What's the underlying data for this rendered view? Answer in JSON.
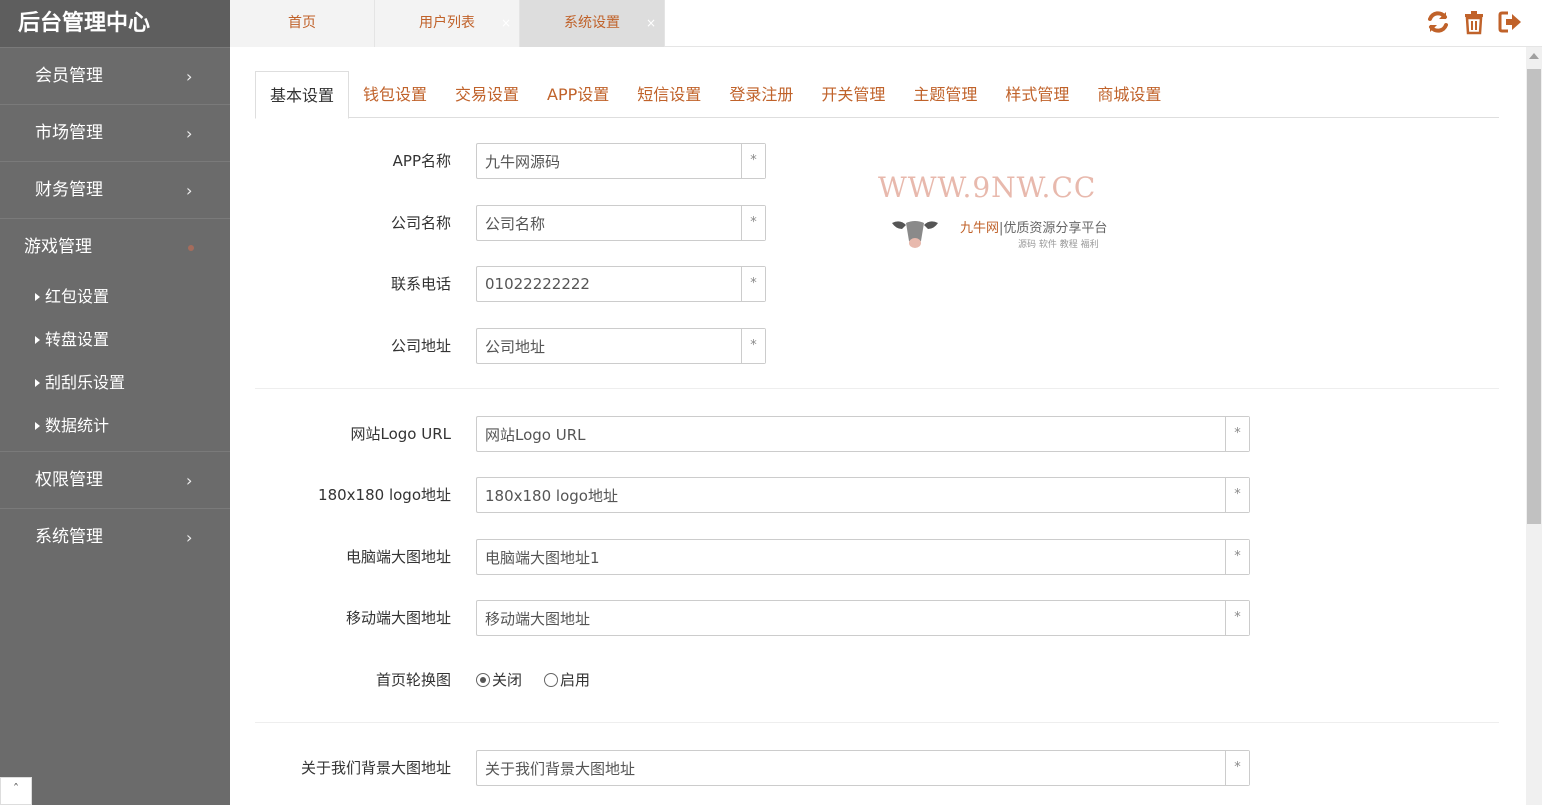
{
  "sidebar": {
    "brand": "后台管理中心",
    "items": [
      {
        "label": "会员管理",
        "chevron": "›"
      },
      {
        "label": "市场管理",
        "chevron": "›"
      },
      {
        "label": "财务管理",
        "chevron": "›"
      },
      {
        "label": "游戏管理"
      },
      {
        "label": "权限管理",
        "chevron": "›"
      },
      {
        "label": "系统管理",
        "chevron": "›"
      }
    ],
    "game_subitems": [
      "红包设置",
      "转盘设置",
      "刮刮乐设置",
      "数据统计"
    ],
    "scroll_top": "ˆ"
  },
  "page_tabs": [
    {
      "label": "首页"
    },
    {
      "label": "用户列表",
      "close": "×"
    },
    {
      "label": "系统设置",
      "close": "×"
    }
  ],
  "toolbar": {
    "icons": [
      "refresh-icon",
      "trash-icon",
      "logout-icon"
    ],
    "accent": "#c0622a"
  },
  "settings_tabs": [
    "基本设置",
    "钱包设置",
    "交易设置",
    "APP设置",
    "短信设置",
    "登录注册",
    "开关管理",
    "主题管理",
    "样式管理",
    "商城设置"
  ],
  "form": {
    "app_name": {
      "label": "APP名称",
      "value": "九牛网源码"
    },
    "company_name": {
      "label": "公司名称",
      "value": "公司名称"
    },
    "phone": {
      "label": "联系电话",
      "value": "01022222222"
    },
    "address": {
      "label": "公司地址",
      "value": "公司地址"
    },
    "logo_url": {
      "label": "网站Logo URL",
      "value": "网站Logo URL"
    },
    "logo_180": {
      "label": "180x180 logo地址",
      "value": "180x180 logo地址"
    },
    "pc_banner": {
      "label": "电脑端大图地址",
      "value": "电脑端大图地址1"
    },
    "mobile_banner": {
      "label": "移动端大图地址",
      "value": "移动端大图地址"
    },
    "carousel": {
      "label": "首页轮换图",
      "options": [
        "关闭",
        "启用"
      ],
      "selected": "关闭"
    },
    "about_bg": {
      "label": "关于我们背景大图地址",
      "value": "关于我们背景大图地址"
    },
    "required_mark": "*"
  },
  "watermark": {
    "url": "WWW.9NW.CC",
    "tagline_brand": "九牛网",
    "tagline_rest": "|优质资源分享平台",
    "sub": "源码 软件 教程 福利"
  }
}
